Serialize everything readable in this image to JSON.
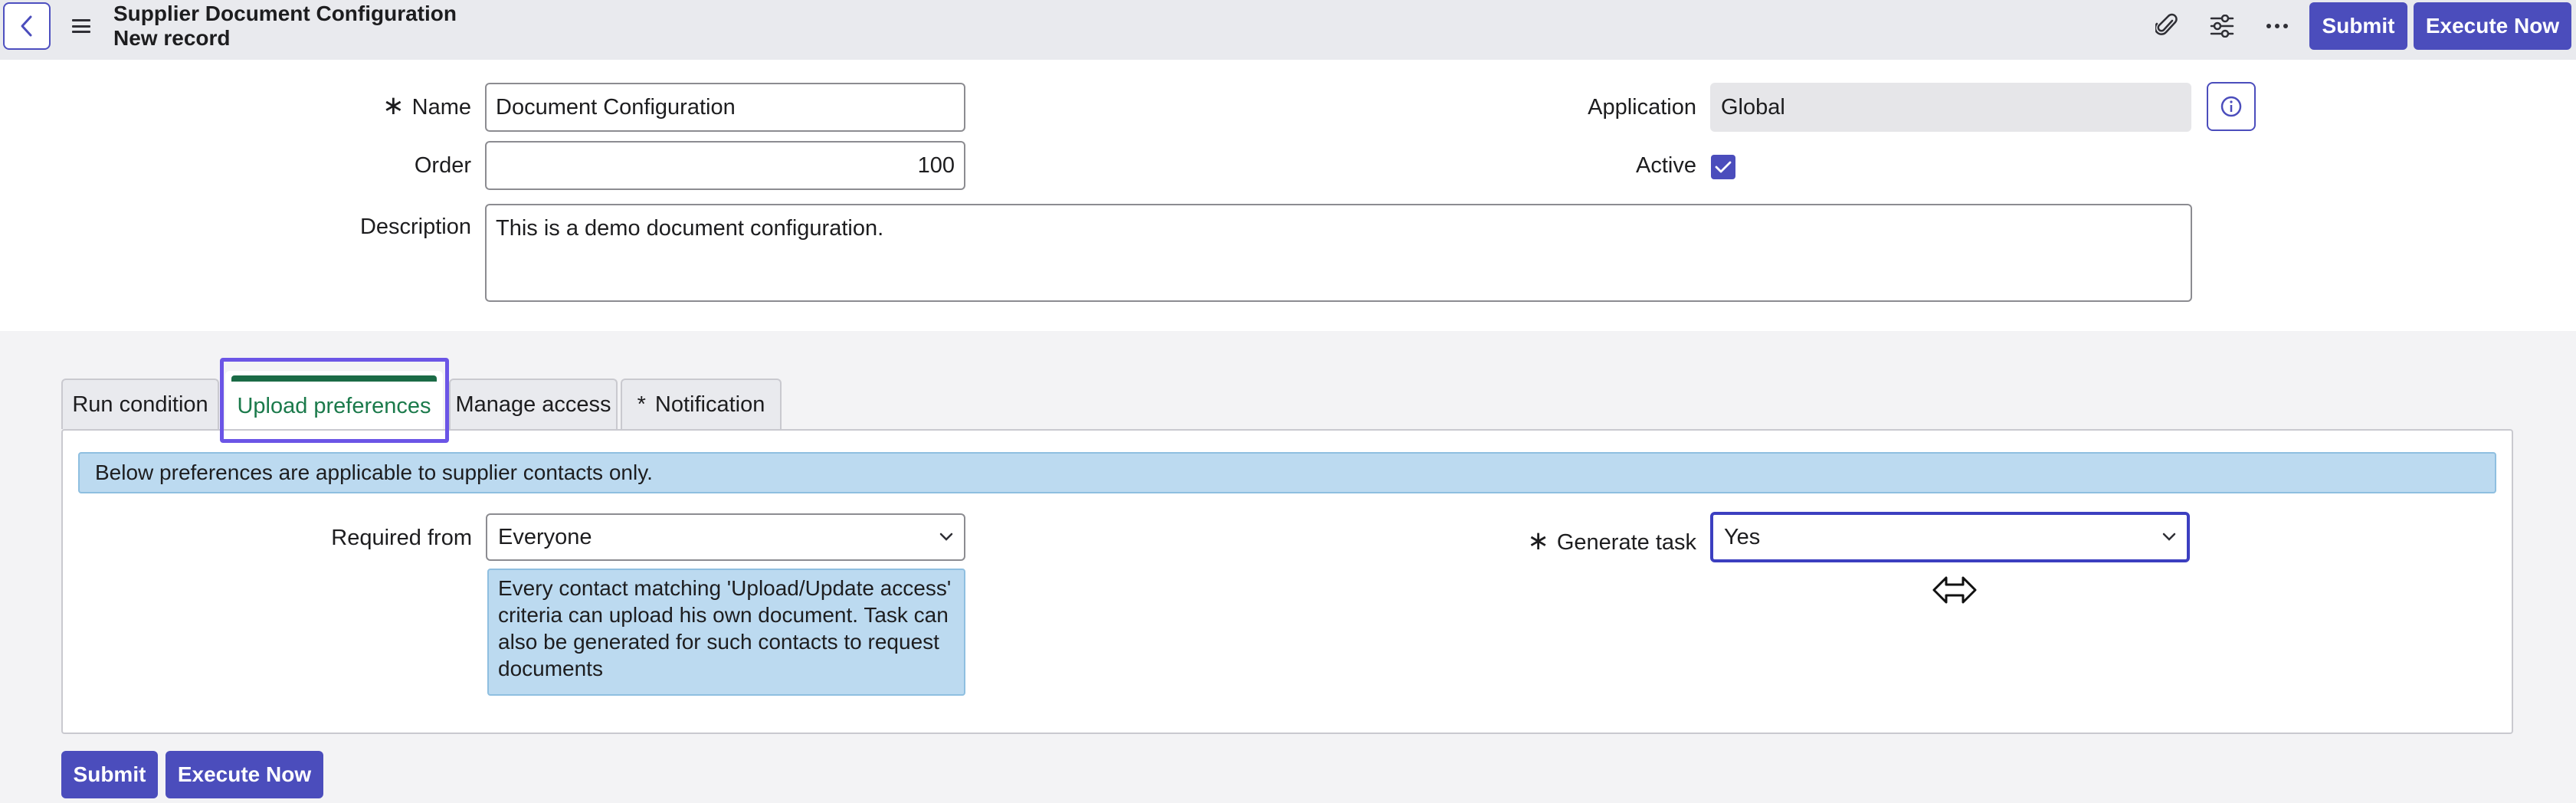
{
  "header": {
    "title": "Supplier Document Configuration",
    "subtitle": "New record",
    "icons": [
      "back-chevron-icon",
      "menu-icon",
      "paperclip-icon",
      "sliders-icon",
      "more-icon"
    ],
    "submit_label": "Submit",
    "execute_label": "Execute Now"
  },
  "form": {
    "name_label": "Name",
    "name_value": "Document Configuration",
    "order_label": "Order",
    "order_value": "100",
    "description_label": "Description",
    "description_value": "This is a demo document configuration.",
    "application_label": "Application",
    "application_value": "Global",
    "active_label": "Active",
    "active_checked": true
  },
  "tabs": [
    {
      "label": "Run condition"
    },
    {
      "label": "Upload preferences",
      "active": true
    },
    {
      "label": "Manage access"
    },
    {
      "label": "Notification",
      "required": true
    }
  ],
  "upload_preferences": {
    "banner": "Below preferences are applicable to supplier contacts only.",
    "required_from_label": "Required from",
    "required_from_value": "Everyone",
    "required_from_hint": "Every contact matching 'Upload/Update access' criteria can upload his own document. Task can also be generated for such contacts to request documents",
    "generate_task_label": "Generate task",
    "generate_task_value": "Yes"
  },
  "footer": {
    "submit_label": "Submit",
    "execute_label": "Execute Now"
  },
  "colors": {
    "primary": "#4b4dbc",
    "active_tab_text": "#1b7a4b",
    "info_banner": "#bcdaf0",
    "focus_outline": "#6b55e6"
  }
}
